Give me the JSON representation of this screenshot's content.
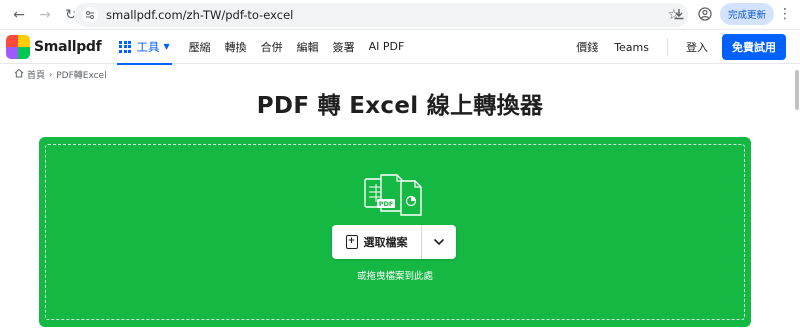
{
  "browser": {
    "url": "smallpdf.com/zh-TW/pdf-to-excel",
    "update_label": "完成更新"
  },
  "header": {
    "brand": "Smallpdf",
    "tools_label": "工具",
    "nav": [
      "壓縮",
      "轉換",
      "合併",
      "編輯",
      "簽署",
      "AI PDF"
    ],
    "pricing": "價錢",
    "teams": "Teams",
    "login": "登入",
    "cta": "免費試用"
  },
  "breadcrumb": {
    "home": "首頁",
    "current": "PDF轉Excel"
  },
  "main": {
    "title": "PDF 轉 Excel 線上轉換器",
    "illustration_label": "PDF",
    "select_button": "選取檔案",
    "drop_hint": "或拖曳檔案到此處"
  },
  "colors": {
    "brand_blue": "#0061fe",
    "dropzone_green": "#14b843"
  },
  "icons": {
    "back": "arrow-left-icon",
    "forward": "arrow-right-icon",
    "reload": "reload-icon",
    "site_info": "site-info-icon",
    "bookmark": "star-icon",
    "download": "download-icon",
    "profile": "profile-icon",
    "menu": "kebab-menu-icon",
    "tools": "grid-icon",
    "home": "home-icon",
    "file": "file-plus-icon",
    "dropdown": "chevron-down-icon"
  }
}
